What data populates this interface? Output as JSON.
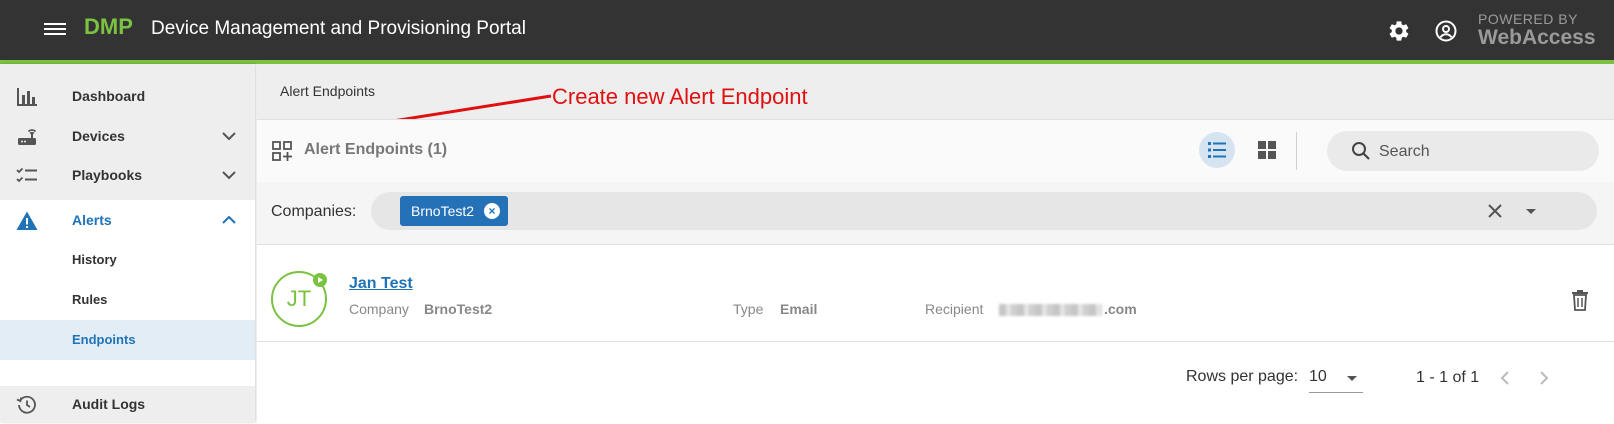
{
  "header": {
    "logo": "DMP",
    "title": "Device Management and Provisioning Portal",
    "powered_by": "POWERED BY",
    "powered_brand": "WebAccess",
    "accent_color": "#7cc242",
    "settings_icon": "gear-icon",
    "account_icon": "account-circle-icon"
  },
  "sidebar": {
    "items": [
      {
        "label": "Dashboard",
        "icon": "bar-chart-icon"
      },
      {
        "label": "Devices",
        "icon": "router-icon"
      },
      {
        "label": "Playbooks",
        "icon": "checklist-icon"
      },
      {
        "label": "Alerts",
        "icon": "warning-icon",
        "expanded": true
      },
      {
        "label": "Audit Logs",
        "icon": "history-icon"
      }
    ],
    "alerts_children": [
      {
        "label": "History"
      },
      {
        "label": "Rules"
      },
      {
        "label": "Endpoints",
        "selected": true
      }
    ]
  },
  "breadcrumb": "Alert Endpoints",
  "annotation": "Create new Alert Endpoint",
  "toolbar": {
    "title": "Alert Endpoints (1)",
    "search_placeholder": "Search"
  },
  "filter": {
    "label": "Companies:",
    "chips": [
      "BrnoTest2"
    ]
  },
  "endpoints": [
    {
      "initials": "JT",
      "name": "Jan Test",
      "company_label": "Company",
      "company": "BrnoTest2",
      "type_label": "Type",
      "type": "Email",
      "recipient_label": "Recipient",
      "recipient_visible": ".com"
    }
  ],
  "pagination": {
    "rows_per_page_label": "Rows per page:",
    "rows_per_page": "10",
    "range": "1 - 1 of 1"
  },
  "colors": {
    "topbar": "#333333",
    "primary_blue": "#1f73b7",
    "chip_blue": "#2471b8",
    "annotation_red": "#e01010"
  }
}
